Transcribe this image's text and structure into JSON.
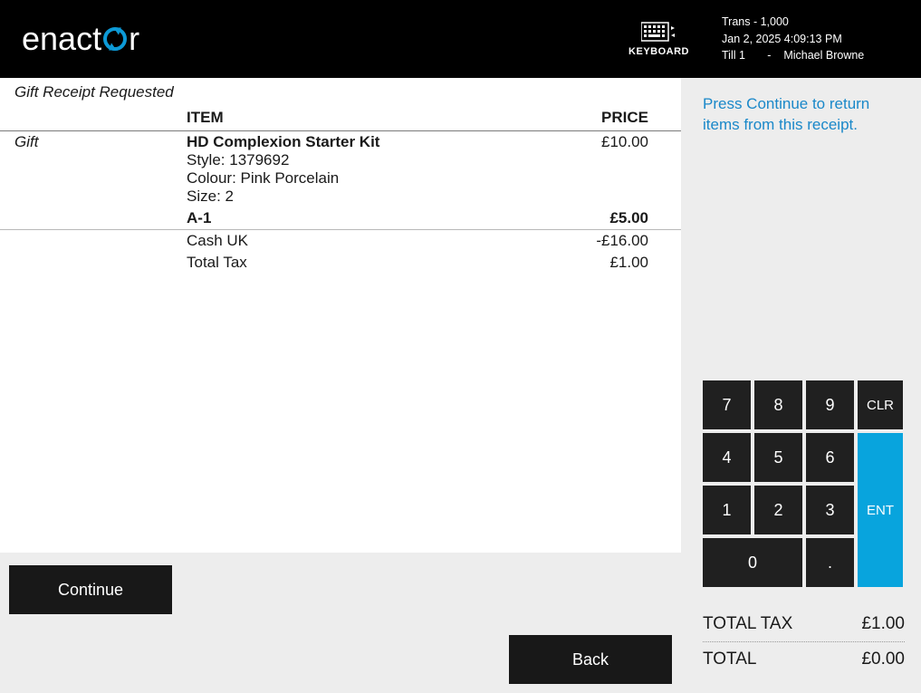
{
  "header": {
    "keyboard_label": "KEYBOARD",
    "trans_line": "Trans - 1,000",
    "date_line": "Jan 2, 2025 4:09:13 PM",
    "till_label": "Till 1",
    "till_sep": "-",
    "user_name": "Michael Browne"
  },
  "receipt": {
    "gift_request": "Gift Receipt Requested",
    "columns": {
      "item": "ITEM",
      "price": "PRICE"
    },
    "gift_label": "Gift",
    "item1": {
      "name": "HD Complexion Starter Kit",
      "style": "Style: 1379692",
      "colour": "Colour: Pink Porcelain",
      "size": "Size: 2",
      "price": "£10.00"
    },
    "item2": {
      "name": "A-1",
      "price": "£5.00"
    },
    "item3": {
      "name": "Cash UK",
      "price": "-£16.00"
    },
    "item4": {
      "name": "Total Tax",
      "price": "£1.00"
    }
  },
  "actions": {
    "continue": "Continue",
    "back": "Back"
  },
  "sidebar": {
    "instruction": "Press Continue to return items from this receipt.",
    "keypad": {
      "k7": "7",
      "k8": "8",
      "k9": "9",
      "clr": "CLR",
      "k4": "4",
      "k5": "5",
      "k6": "6",
      "ent": "ENT",
      "k1": "1",
      "k2": "2",
      "k3": "3",
      "k0": "0",
      "dot": "."
    },
    "totals": {
      "tax_label": "TOTAL TAX",
      "tax_value": "£1.00",
      "total_label": "TOTAL",
      "total_value": "£0.00"
    }
  }
}
